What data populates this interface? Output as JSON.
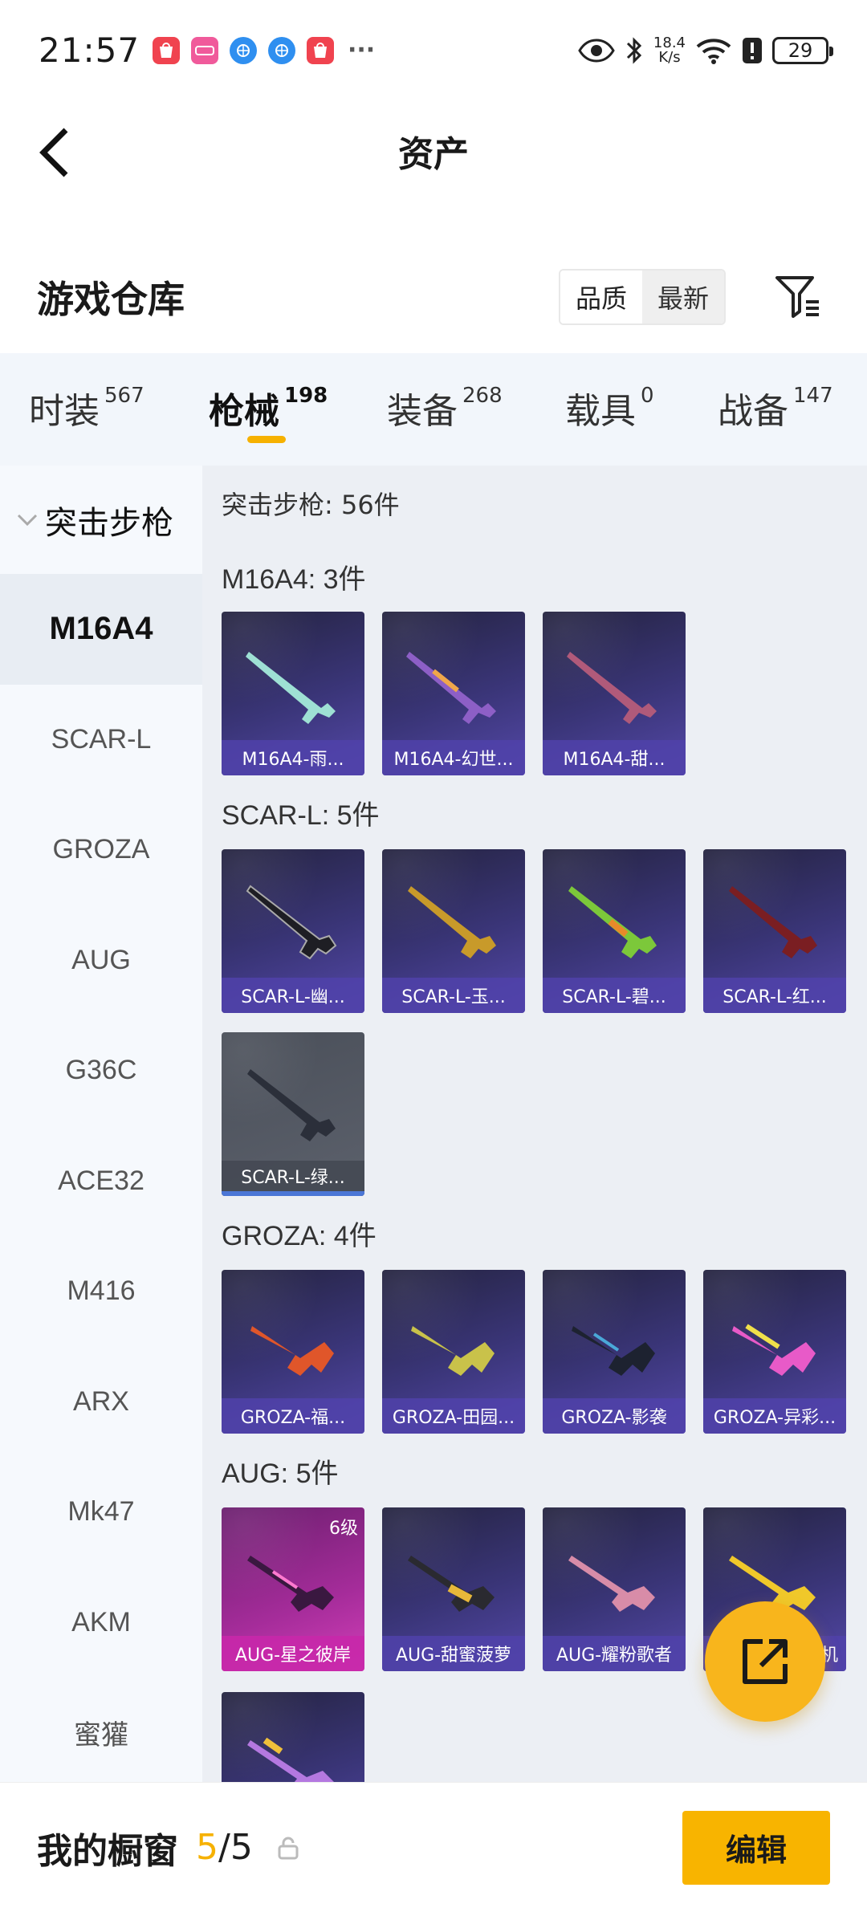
{
  "status_bar": {
    "time": "21:57",
    "net_speed_value": "18.4",
    "net_speed_unit": "K/s",
    "battery": "29",
    "notification_icons": [
      "red-bag-icon",
      "pink-app-icon",
      "blue-browser-icon",
      "blue-browser-icon",
      "red-bag-icon"
    ],
    "more": "···"
  },
  "nav": {
    "title": "资产"
  },
  "header": {
    "title": "游戏仓库",
    "sort_quality": "品质",
    "sort_newest": "最新"
  },
  "tabs": [
    {
      "label": "时装",
      "count": "567"
    },
    {
      "label": "枪械",
      "count": "198",
      "active": true
    },
    {
      "label": "装备",
      "count": "268"
    },
    {
      "label": "载具",
      "count": "0"
    },
    {
      "label": "战备",
      "count": "147"
    }
  ],
  "sidebar": {
    "category": "突击步枪",
    "items": [
      "M16A4",
      "SCAR-L",
      "GROZA",
      "AUG",
      "G36C",
      "ACE32",
      "M416",
      "ARX",
      "Mk47",
      "AKM",
      "蜜獾"
    ],
    "active_item": "M16A4"
  },
  "content": {
    "total": "突击步枪: 56件",
    "groups": [
      {
        "title": "M16A4: 3件",
        "items": [
          "M16A4-雨...",
          "M16A4-幻世...",
          "M16A4-甜..."
        ]
      },
      {
        "title": "SCAR-L: 5件",
        "items": [
          "SCAR-L-幽...",
          "SCAR-L-玉...",
          "SCAR-L-碧...",
          "SCAR-L-红...",
          "SCAR-L-绿..."
        ]
      },
      {
        "title": "GROZA: 4件",
        "items": [
          "GROZA-福...",
          "GROZA-田园...",
          "GROZA-影袭",
          "GROZA-异彩..."
        ]
      },
      {
        "title": "AUG: 5件",
        "items": [
          "AUG-星之彼岸",
          "AUG-甜蜜菠萝",
          "AUG-耀粉歌者",
          "机"
        ],
        "first_level": "6级"
      }
    ]
  },
  "bottom": {
    "label": "我的橱窗",
    "current": "5",
    "separator": "/",
    "max": "5",
    "edit": "编辑"
  },
  "colors": {
    "accent": "#f8b400",
    "card_purple": "#3a3578",
    "card_pink": "#c8289a"
  }
}
